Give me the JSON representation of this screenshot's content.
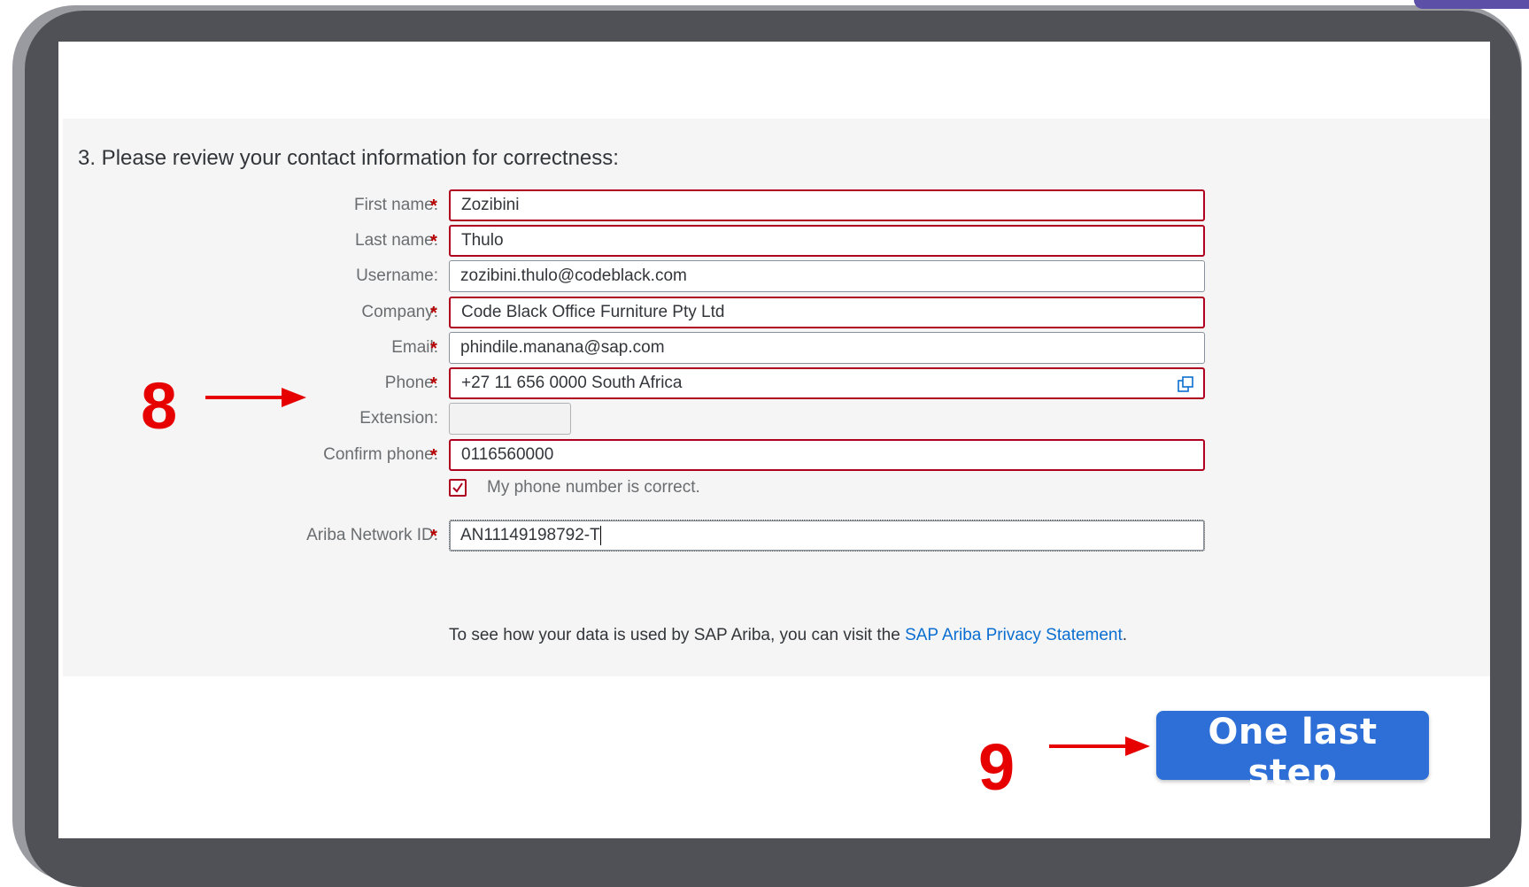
{
  "form": {
    "section_title": "3. Please review your contact information for correctness:",
    "required_marker": "*",
    "fields": [
      {
        "label": "First name:",
        "value": "Zozibini",
        "required": true
      },
      {
        "label": "Last name:",
        "value": "Thulo",
        "required": true
      },
      {
        "label": "Username:",
        "value": "zozibini.thulo@codeblack.com",
        "required": false
      },
      {
        "label": "Company:",
        "value": "Code Black Office Furniture Pty Ltd",
        "required": true
      },
      {
        "label": "Email:",
        "value": "phindile.manana@sap.com",
        "required": true
      },
      {
        "label": "Phone:",
        "value": "+27 11 656 0000 South Africa",
        "required": true
      },
      {
        "label": "Extension:",
        "value": "",
        "required": false
      },
      {
        "label": "Confirm phone:",
        "value": "0116560000",
        "required": true
      }
    ],
    "phone_confirm_checkbox": {
      "label": "My phone number is correct.",
      "checked": true
    },
    "ariba_id": {
      "label": "Ariba Network ID:",
      "value": "AN11149198792-T",
      "required": true
    },
    "privacy_text": "To see how your data is used by SAP Ariba, you can visit the ",
    "privacy_link": "SAP Ariba Privacy Statement",
    "privacy_end": "."
  },
  "actions": {
    "primary_button": "One last step"
  },
  "annotations": {
    "step_8": "8",
    "step_9": "9",
    "color": "#e60000"
  },
  "colors": {
    "error_border": "#b00020",
    "primary": "#2d6fd6",
    "link": "#0a6ed1",
    "frame": "#4f5157"
  },
  "icons": {
    "phone_field": "copy-icon",
    "checkbox": "checkmark-icon",
    "annotation": "arrow-right-icon"
  }
}
